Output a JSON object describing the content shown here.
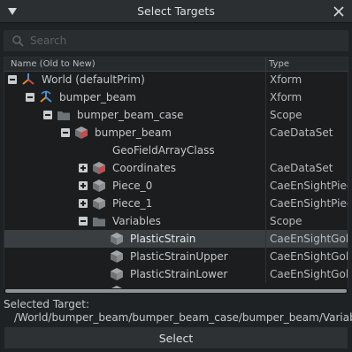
{
  "window": {
    "title": "Select Targets"
  },
  "search": {
    "placeholder": "Search",
    "value": ""
  },
  "tree": {
    "columns": {
      "name": "Name (Old to New)",
      "type": "Type"
    },
    "rows": [
      {
        "name": "World (defaultPrim)",
        "type": "Xform",
        "icon": "xform-world-icon",
        "expander": "expanded"
      },
      {
        "name": "bumper_beam",
        "type": "Xform",
        "icon": "xform-icon",
        "expander": "expanded"
      },
      {
        "name": "bumper_beam_case",
        "type": "Scope",
        "icon": "folder-icon",
        "expander": "expanded"
      },
      {
        "name": "bumper_beam",
        "type": "CaeDataSet",
        "icon": "dataset-cube-icon",
        "expander": "expanded"
      },
      {
        "name": "GeoFieldArrayClass",
        "type": "",
        "icon": "",
        "expander": "none"
      },
      {
        "name": "Coordinates",
        "type": "CaeDataSet",
        "icon": "dataset-cube-icon",
        "expander": "collapsed"
      },
      {
        "name": "Piece_0",
        "type": "CaeEnSightPiece",
        "icon": "cube-icon",
        "expander": "collapsed"
      },
      {
        "name": "Piece_1",
        "type": "CaeEnSightPiece",
        "icon": "cube-icon",
        "expander": "collapsed"
      },
      {
        "name": "Variables",
        "type": "Scope",
        "icon": "folder-icon",
        "expander": "expanded"
      },
      {
        "name": "PlasticStrain",
        "type": "CaeEnSightGold",
        "icon": "cube-icon",
        "expander": "none",
        "selected": true
      },
      {
        "name": "PlasticStrainUpper",
        "type": "CaeEnSightGold",
        "icon": "cube-icon",
        "expander": "none"
      },
      {
        "name": "PlasticStrainLower",
        "type": "CaeEnSightGold",
        "icon": "cube-icon",
        "expander": "none"
      }
    ]
  },
  "selection": {
    "label": "Selected Target:",
    "path": "/World/bumper_beam/bumper_beam_case/bumper_beam/Variables/PlasticStrain"
  },
  "select_button": {
    "label": "Select"
  },
  "colors": {
    "background": "#1f2224",
    "selected_row": "#3a3e41",
    "dataset_red": "#c94a4a",
    "xform_blue": "#4a90d9",
    "xform_orange": "#e0892e"
  }
}
